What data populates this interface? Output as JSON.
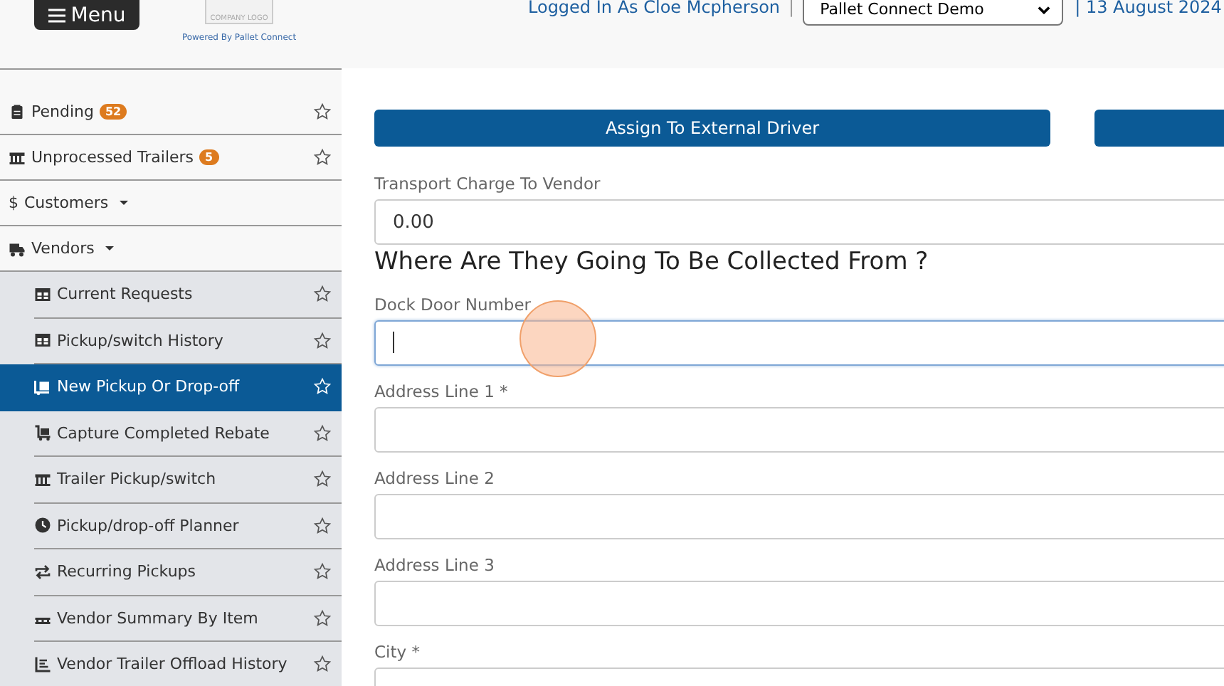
{
  "header": {
    "menu_button": "Menu",
    "logo_text": "COMPANY LOGO",
    "powered_by": "Powered By Pallet Connect",
    "user": "Logged In As Cloe Mcpherson",
    "separator": "|",
    "company_select": "Pallet Connect Demo",
    "date": "| 13 August 2024"
  },
  "sidebar": {
    "items": [
      {
        "label": "Pending",
        "badge": "52"
      },
      {
        "label": "Unprocessed Trailers",
        "badge": "5"
      },
      {
        "label": "Customers",
        "prefix": "$"
      },
      {
        "label": "Vendors",
        "expanded": true,
        "children": [
          {
            "label": "Current Requests",
            "selected": false
          },
          {
            "label": "Pickup/switch History",
            "selected": false
          },
          {
            "label": "New Pickup Or Drop-off",
            "selected": true
          },
          {
            "label": "Capture Completed Rebate",
            "selected": false
          },
          {
            "label": "Trailer Pickup/switch",
            "selected": false
          },
          {
            "label": "Pickup/drop-off Planner",
            "selected": false
          },
          {
            "label": "Recurring Pickups",
            "selected": false
          },
          {
            "label": "Vendor Summary By Item",
            "selected": false
          },
          {
            "label": "Vendor Trailer Offload History",
            "selected": false
          }
        ]
      }
    ]
  },
  "main": {
    "buttons": [
      {
        "kind": "labeled",
        "label": "Assign To External Driver"
      },
      {
        "kind": "cut_off"
      }
    ],
    "fields": [
      {
        "kind": "field",
        "label": "Transport Charge To Vendor",
        "value": "0.00",
        "focused": false
      },
      {
        "kind": "heading",
        "label": "Where Are They Going To Be Collected From ?"
      },
      {
        "kind": "field",
        "label": "Dock Door Number",
        "focused": true
      },
      {
        "kind": "field",
        "label": "Address Line 1 *",
        "focused": false
      },
      {
        "kind": "field",
        "label": "Address Line 2",
        "focused": false
      },
      {
        "kind": "field",
        "label": "Address Line 3",
        "focused": false
      },
      {
        "kind": "field",
        "label": "City *",
        "focused": false
      }
    ]
  }
}
